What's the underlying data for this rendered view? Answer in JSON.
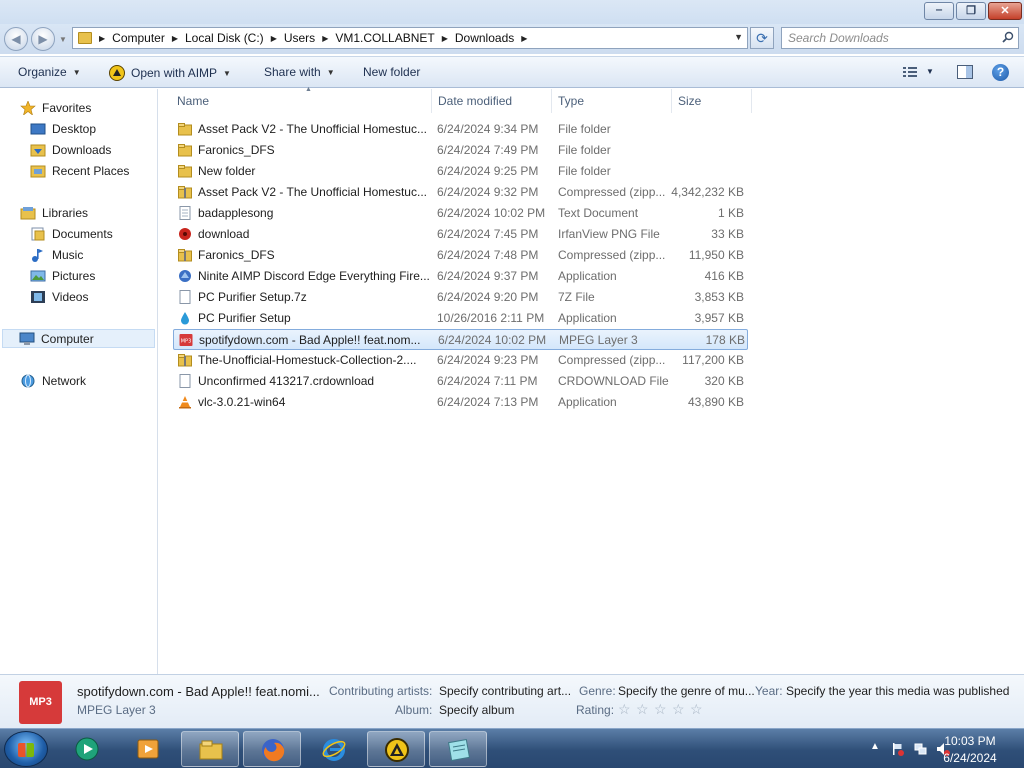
{
  "window": {
    "controls": [
      "minimize",
      "maximize",
      "close"
    ]
  },
  "address": {
    "crumbs": [
      "Computer",
      "Local Disk (C:)",
      "Users",
      "VM1.COLLABNET",
      "Downloads"
    ]
  },
  "search": {
    "placeholder": "Search Downloads"
  },
  "commands": {
    "organize": "Organize",
    "open_with": "Open with AIMP",
    "share_with": "Share with",
    "new_folder": "New folder"
  },
  "nav": {
    "favorites": "Favorites",
    "desktop": "Desktop",
    "downloads": "Downloads",
    "recent_places": "Recent Places",
    "libraries": "Libraries",
    "documents": "Documents",
    "music": "Music",
    "pictures": "Pictures",
    "videos": "Videos",
    "computer": "Computer",
    "network": "Network"
  },
  "columns": {
    "name": "Name",
    "date": "Date modified",
    "type": "Type",
    "size": "Size"
  },
  "files": [
    {
      "name": "Asset Pack V2 - The Unofficial Homestuc...",
      "date": "6/24/2024 9:34 PM",
      "type": "File folder",
      "size": "",
      "icon": "folder-icon"
    },
    {
      "name": "Faronics_DFS",
      "date": "6/24/2024 7:49 PM",
      "type": "File folder",
      "size": "",
      "icon": "folder-icon"
    },
    {
      "name": "New folder",
      "date": "6/24/2024 9:25 PM",
      "type": "File folder",
      "size": "",
      "icon": "folder-icon"
    },
    {
      "name": "Asset Pack V2 - The Unofficial Homestuc...",
      "date": "6/24/2024 9:32 PM",
      "type": "Compressed (zipp...",
      "size": "4,342,232 KB",
      "icon": "zip-folder-icon"
    },
    {
      "name": "badapplesong",
      "date": "6/24/2024 10:02 PM",
      "type": "Text Document",
      "size": "1 KB",
      "icon": "text-document-icon"
    },
    {
      "name": "download",
      "date": "6/24/2024 7:45 PM",
      "type": "IrfanView PNG File",
      "size": "33 KB",
      "icon": "irfanview-icon"
    },
    {
      "name": "Faronics_DFS",
      "date": "6/24/2024 7:48 PM",
      "type": "Compressed (zipp...",
      "size": "11,950 KB",
      "icon": "zip-folder-icon"
    },
    {
      "name": "Ninite AIMP Discord Edge Everything Fire...",
      "date": "6/24/2024 9:37 PM",
      "type": "Application",
      "size": "416 KB",
      "icon": "ninite-icon"
    },
    {
      "name": "PC Purifier Setup.7z",
      "date": "6/24/2024 9:20 PM",
      "type": "7Z File",
      "size": "3,853 KB",
      "icon": "blank-file-icon"
    },
    {
      "name": "PC Purifier Setup",
      "date": "10/26/2016 2:11 PM",
      "type": "Application",
      "size": "3,957 KB",
      "icon": "droplet-icon"
    },
    {
      "name": "spotifydown.com - Bad Apple!! feat.nom...",
      "date": "6/24/2024 10:02 PM",
      "type": "MPEG Layer 3",
      "size": "178 KB",
      "icon": "mp3-icon"
    },
    {
      "name": "The-Unofficial-Homestuck-Collection-2....",
      "date": "6/24/2024 9:23 PM",
      "type": "Compressed (zipp...",
      "size": "117,200 KB",
      "icon": "zip-folder-icon"
    },
    {
      "name": "Unconfirmed 413217.crdownload",
      "date": "6/24/2024 7:11 PM",
      "type": "CRDOWNLOAD File",
      "size": "320 KB",
      "icon": "blank-file-icon"
    },
    {
      "name": "vlc-3.0.21-win64",
      "date": "6/24/2024 7:13 PM",
      "type": "Application",
      "size": "43,890 KB",
      "icon": "vlc-cone-icon"
    }
  ],
  "selected_index": 10,
  "details": {
    "thumb_label": "MP3",
    "file_name": "spotifydown.com - Bad Apple!! feat.nomi...",
    "file_type": "MPEG Layer 3",
    "contrib_label": "Contributing artists:",
    "contrib_value": "Specify contributing art...",
    "album_label": "Album:",
    "album_value": "Specify album",
    "genre_label": "Genre:",
    "genre_value": "Specify the genre of mu...",
    "year_label": "Year:",
    "year_value": "Specify the year this media was published",
    "rating_label": "Rating:",
    "rating_value": 0,
    "rating_max": 5
  },
  "taskbar": {
    "apps": [
      "windows-media-player-icon",
      "media-center-icon",
      "explorer-icon",
      "firefox-icon",
      "internet-explorer-icon",
      "aimp-icon",
      "notepad-icon"
    ],
    "clock_time": "10:03 PM",
    "clock_date": "6/24/2024"
  },
  "colors": {
    "selection_bg": "#d4e7fb",
    "selection_border": "#84acdd",
    "folder": "#e8c14c",
    "mp3_red": "#d63a3a"
  }
}
